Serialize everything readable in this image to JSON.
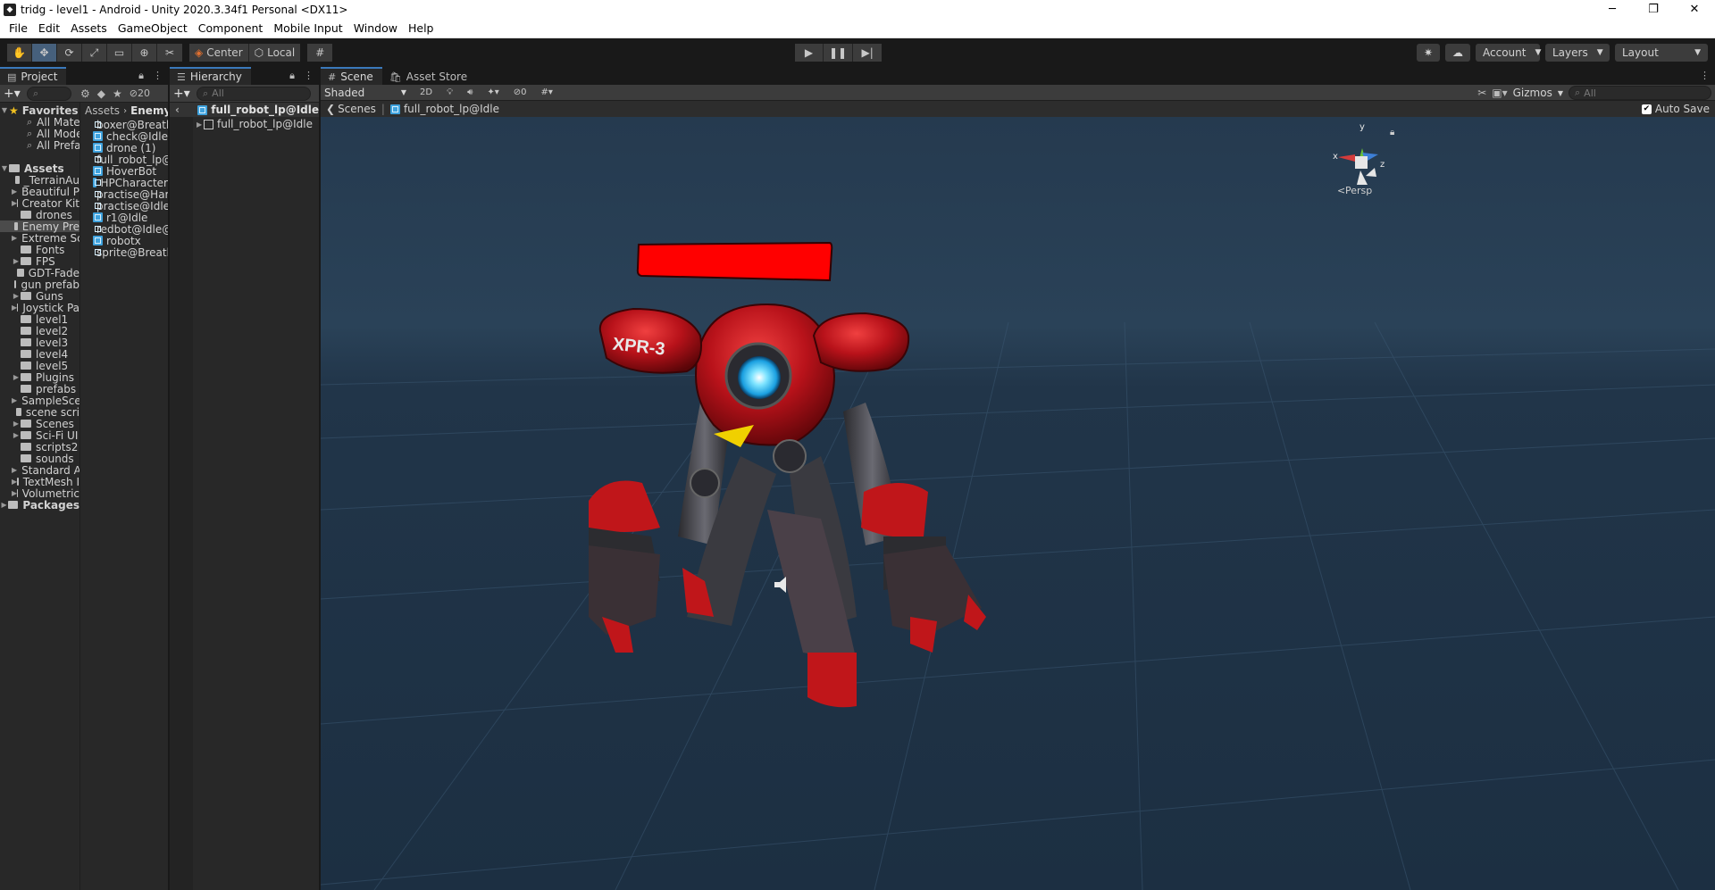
{
  "window": {
    "title": "tridg - level1 - Android - Unity 2020.3.34f1 Personal <DX11>"
  },
  "menu": [
    "File",
    "Edit",
    "Assets",
    "GameObject",
    "Component",
    "Mobile Input",
    "Window",
    "Help"
  ],
  "toolbar": {
    "pivot_label": "Center",
    "space_label": "Local",
    "account_label": "Account",
    "layers_label": "Layers",
    "layout_label": "Layout"
  },
  "project": {
    "tab_label": "Project",
    "hidden_count": "20",
    "favorites_label": "Favorites",
    "favorites": [
      "All Materia",
      "All Models",
      "All Prefabs"
    ],
    "assets_label": "Assets",
    "folders": [
      "_TerrainAu",
      "Beautiful P",
      "Creator Kit",
      "drones",
      "Enemy Pre",
      "Extreme Sc",
      "Fonts",
      "FPS",
      "GDT-Fade",
      "gun prefab",
      "Guns",
      "Joystick Pa",
      "level1",
      "level2",
      "level3",
      "level4",
      "level5",
      "Plugins",
      "prefabs",
      "SampleSce",
      "scene scri",
      "Scenes",
      "Sci-Fi UI",
      "scripts2",
      "sounds",
      "Standard A",
      "TextMesh I",
      "Volumetric"
    ],
    "packages_label": "Packages",
    "breadcrumb": [
      "Assets",
      "Enemy Pre"
    ],
    "files": [
      "boxer@Breathi",
      "check@Idle",
      "drone (1)",
      "full_robot_lp@Id",
      "HoverBot",
      "HPCharacter",
      "practise@Hard",
      "practise@Idle@",
      "r1@Idle",
      "redbot@Idle@Id",
      "robotx",
      "sprite@Breathi"
    ]
  },
  "hierarchy": {
    "tab_label": "Hierarchy",
    "search_placeholder": "All",
    "scene_name": "full_robot_lp@Idle",
    "child_name": "full_robot_lp@Idle"
  },
  "scene": {
    "tab_label": "Scene",
    "asset_store_label": "Asset Store",
    "shading_mode": "Shaded",
    "mode_2d": "2D",
    "hidden_objects": "0",
    "gizmos_label": "Gizmos",
    "search_placeholder": "All",
    "breadcrumb_scenes": "Scenes",
    "breadcrumb_prefab": "full_robot_lp@Idle",
    "auto_save_label": "Auto Save",
    "auto_save_checked": true,
    "projection_label": "Persp",
    "robot_label": "XPR-3",
    "axis_x": "x",
    "axis_y": "y",
    "axis_z": "z"
  },
  "colors": {
    "accent_tab": "#3a79bb",
    "health_bar": "#ff0000",
    "robot_red": "#c0161a",
    "viewport_bg": "#223345"
  }
}
